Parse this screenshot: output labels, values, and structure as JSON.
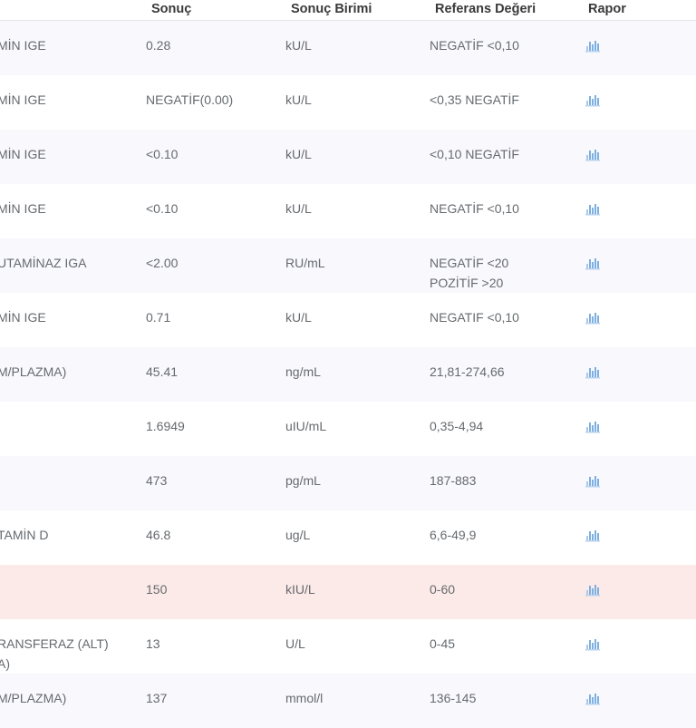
{
  "table": {
    "header": {
      "name": "",
      "result": "Sonuç",
      "unit": "Sonuç Birimi",
      "reference": "Referans Değeri",
      "report": "Rapor"
    },
    "rows": [
      {
        "name": [
          "MİN IGE"
        ],
        "result": "0.28",
        "unit": "kU/L",
        "reference": [
          "NEGATİF <0,10"
        ],
        "abnormal": false
      },
      {
        "name": [
          "MİN IGE"
        ],
        "result": "NEGATİF(0.00)",
        "unit": "kU/L",
        "reference": [
          "<0,35 NEGATİF"
        ],
        "abnormal": false
      },
      {
        "name": [
          "MİN IGE"
        ],
        "result": "<0.10",
        "unit": "kU/L",
        "reference": [
          "<0,10 NEGATİF"
        ],
        "abnormal": false
      },
      {
        "name": [
          "MİN IGE"
        ],
        "result": "<0.10",
        "unit": "kU/L",
        "reference": [
          "NEGATİF <0,10"
        ],
        "abnormal": false
      },
      {
        "name": [
          "UTAMİNAZ IGA"
        ],
        "result": "<2.00",
        "unit": "RU/mL",
        "reference": [
          "NEGATİF <20",
          "POZİTİF >20"
        ],
        "abnormal": false
      },
      {
        "name": [
          "MİN IGE"
        ],
        "result": "0.71",
        "unit": "kU/L",
        "reference": [
          "NEGATIF <0,10"
        ],
        "abnormal": false
      },
      {
        "name": [
          "M/PLAZMA)"
        ],
        "result": "45.41",
        "unit": "ng/mL",
        "reference": [
          "21,81-274,66"
        ],
        "abnormal": false
      },
      {
        "name": [],
        "result": "1.6949",
        "unit": "uIU/mL",
        "reference": [
          "0,35-4,94"
        ],
        "abnormal": false
      },
      {
        "name": [],
        "result": "473",
        "unit": "pg/mL",
        "reference": [
          "187-883"
        ],
        "abnormal": false
      },
      {
        "name": [
          "TAMİN D"
        ],
        "result": "46.8",
        "unit": "ug/L",
        "reference": [
          "6,6-49,9"
        ],
        "abnormal": false
      },
      {
        "name": [],
        "result": "150",
        "unit": "kIU/L",
        "reference": [
          "0-60"
        ],
        "abnormal": true
      },
      {
        "name": [
          "RANSFERAZ (ALT)",
          "A)"
        ],
        "result": "13",
        "unit": "U/L",
        "reference": [
          "0-45"
        ],
        "abnormal": false
      },
      {
        "name": [
          "M/PLAZMA)"
        ],
        "result": "137",
        "unit": "mmol/l",
        "reference": [
          "136-145"
        ],
        "abnormal": false
      }
    ],
    "icons": {
      "report": "bar-chart-icon"
    },
    "colors": {
      "accent_blue": "#7dafe0",
      "abnormal_row_bg": "#fceae8",
      "alt_row_bg": "#f8f8fd",
      "header_text": "#3a3a3a",
      "body_text": "#666a6e"
    }
  }
}
